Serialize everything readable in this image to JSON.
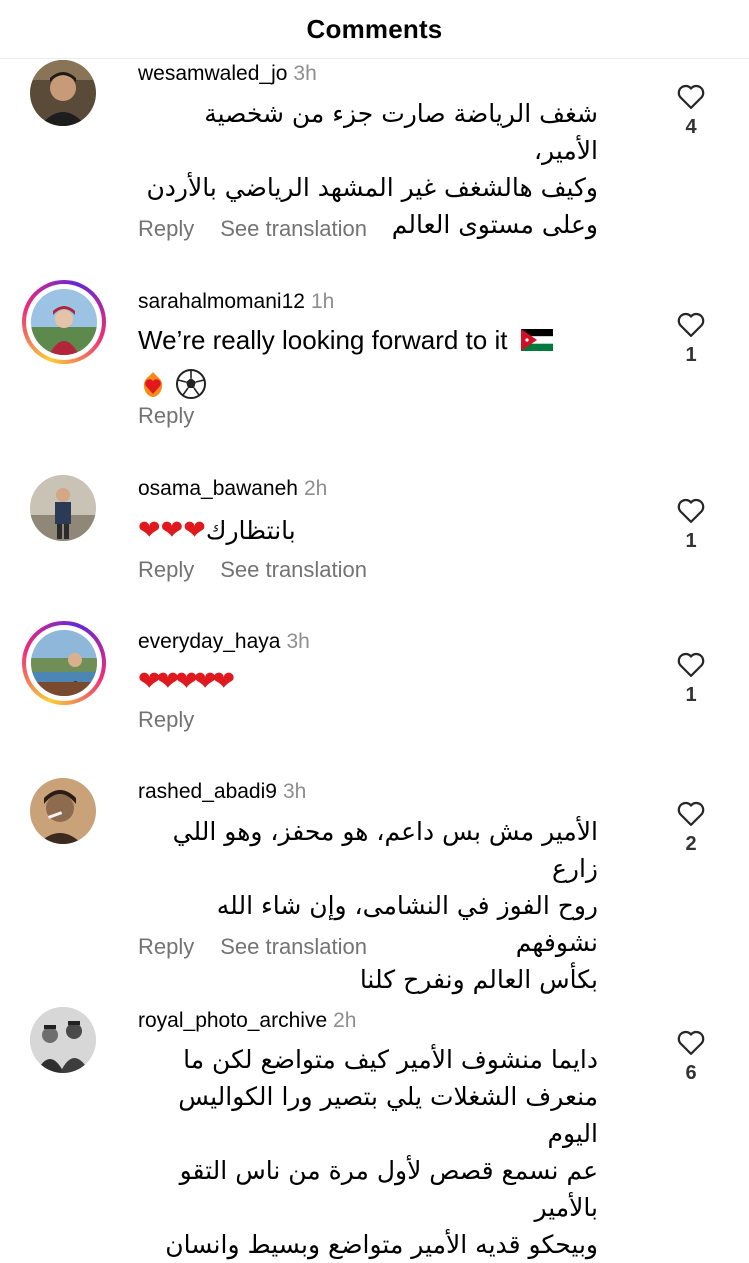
{
  "header": {
    "title": "Comments"
  },
  "comments": [
    {
      "username": "wesamwaled_jo",
      "time": "3h",
      "lines": [
        "شغف الرياضة صارت جزء من شخصية الأمير،",
        "وكيف هالشغف غير المشهد الرياضي بالأردن",
        "وعلى مستوى العالم"
      ],
      "reply": "Reply",
      "translate": "See translation",
      "likes": "4"
    },
    {
      "username": "sarahalmomani12",
      "time": "1h",
      "text1": "We’re really looking forward to it",
      "flag": "🇯🇴",
      "emojis": "❤️‍🔥⚽",
      "reply": "Reply",
      "likes": "1"
    },
    {
      "username": "osama_bawaneh",
      "time": "2h",
      "text_ar": "بانتظارك",
      "hearts": "❤❤❤",
      "hearts_left": "❤❤",
      "reply": "Reply",
      "translate": "See translation",
      "likes": "1"
    },
    {
      "username": "everyday_haya",
      "time": "3h",
      "hearts": "❤❤❤❤❤",
      "reply": "Reply",
      "likes": "1"
    },
    {
      "username": "rashed_abadi9",
      "time": "3h",
      "lines": [
        "الأمير مش بس داعم، هو محفز، وهو اللي زارع",
        "روح الفوز في النشامى، وإن شاء الله نشوفهم",
        "بكأس العالم ونفرح كلنا"
      ],
      "reply": "Reply",
      "translate": "See translation",
      "likes": "2"
    },
    {
      "username": "royal_photo_archive",
      "time": "2h",
      "lines": [
        "دايما منشوف الأمير كيف متواضع لكن ما",
        "منعرف الشغلات يلي بتصير ورا الكواليس اليوم",
        "عم نسمع قصص لأول مرة من ناس التقو بالأمير",
        "وبيحكو قديه الأمير متواضع وبسيط وانسان"
      ],
      "likes": "6"
    }
  ],
  "colors": {
    "secondary_text": "#737373",
    "time_text": "#8e8e8e",
    "heart_red": "#e0191e"
  },
  "icons": {
    "like": "heart-outline-icon"
  }
}
